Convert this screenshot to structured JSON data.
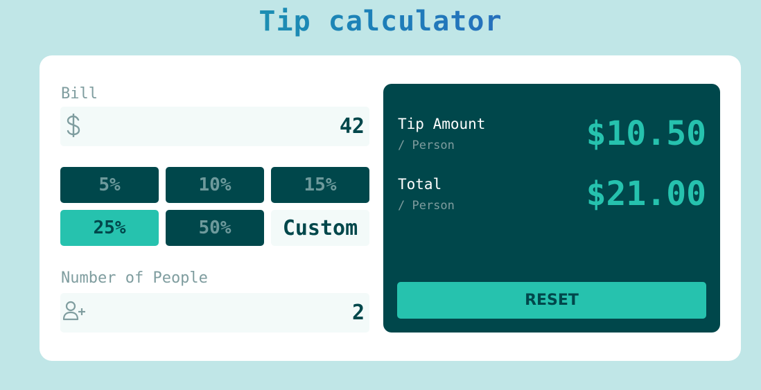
{
  "app": {
    "title": "Tip calculator"
  },
  "bill": {
    "label": "Bill",
    "icon": "dollar-icon",
    "value": "42"
  },
  "tips": {
    "options": [
      {
        "label": "5%",
        "active": false
      },
      {
        "label": "10%",
        "active": false
      },
      {
        "label": "15%",
        "active": false
      },
      {
        "label": "25%",
        "active": true
      },
      {
        "label": "50%",
        "active": false
      }
    ],
    "custom_placeholder": "Custom"
  },
  "people": {
    "label": "Number of People",
    "icon": "person-add-icon",
    "value": "2"
  },
  "results": {
    "tip_amount_label": "Tip Amount",
    "tip_per_person_label": "/ Person",
    "tip_amount_value": "$10.50",
    "total_label": "Total",
    "total_per_person_label": "/ Person",
    "total_value": "$21.00",
    "reset_label": "RESET"
  },
  "colors": {
    "background": "#c0e6e7",
    "dark_teal": "#00474b",
    "accent": "#26c2ae",
    "input_bg": "#f3faf9",
    "muted": "#7f9d9f"
  }
}
